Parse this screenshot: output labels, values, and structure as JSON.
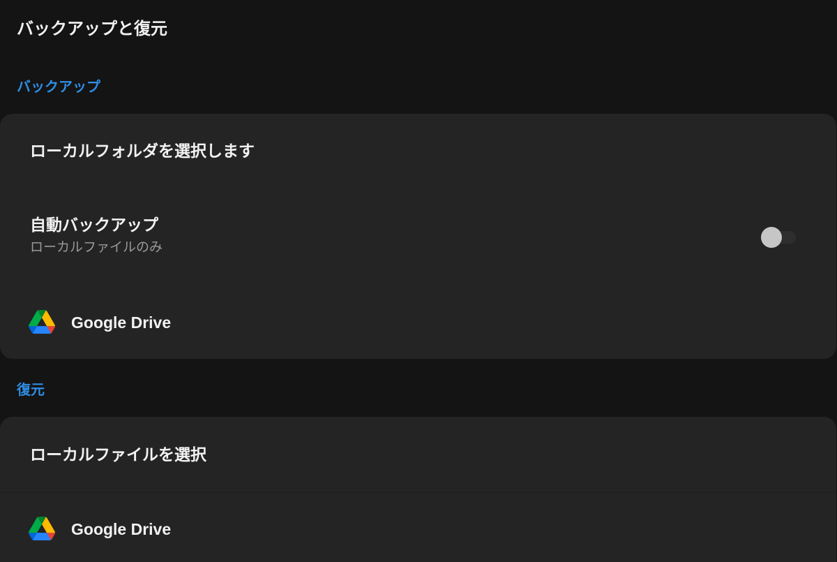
{
  "page": {
    "title": "バックアップと復元"
  },
  "backup": {
    "header": "バックアップ",
    "select_local_folder": "ローカルフォルダを選択します",
    "auto_backup": {
      "title": "自動バックアップ",
      "subtitle": "ローカルファイルのみ",
      "enabled": false
    },
    "google_drive": {
      "label": "Google Drive",
      "icon": "google-drive-icon"
    }
  },
  "restore": {
    "header": "復元",
    "select_local_file": "ローカルファイルを選択",
    "google_drive": {
      "label": "Google Drive",
      "icon": "google-drive-icon"
    }
  },
  "colors": {
    "background": "#141414",
    "card": "#242424",
    "accent": "#2f8ee5",
    "text_primary": "#f2f2f2",
    "text_secondary": "#9a9a9a",
    "drive_green": "#1fa463",
    "drive_yellow": "#ffd04b",
    "drive_blue": "#4688f4",
    "drive_red": "#ea4335"
  }
}
